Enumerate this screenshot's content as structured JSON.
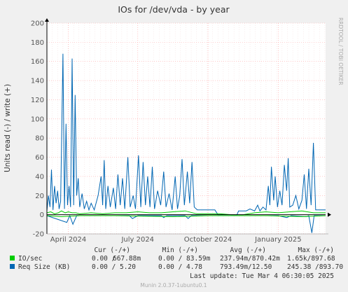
{
  "chart_data": {
    "type": "line",
    "title": "IOs for /dev/vda - by year",
    "ylabel": "Units read (-) / write (+)",
    "side_label": "RRDTOOL / TOBI OETIKER",
    "ylim": [
      -20,
      200
    ],
    "yticks": [
      -20,
      0,
      20,
      40,
      60,
      80,
      100,
      120,
      140,
      160,
      180,
      200
    ],
    "xticks": [
      "April 2024",
      "July 2024",
      "October 2024",
      "January 2025"
    ],
    "x_range": [
      "2024-03-04",
      "2025-03-04"
    ],
    "x_tick_dates": [
      "2024-04-01",
      "2024-07-01",
      "2024-10-01",
      "2025-01-01"
    ],
    "colors": {
      "io": "#00cc00",
      "req": "#0066b3",
      "grid": "#ffaaaa",
      "zero": "#000000"
    },
    "series": [
      {
        "name": "IO/sec",
        "color": "#00cc00",
        "write": [
          [
            "2024-03-04",
            2
          ],
          [
            "2024-03-09",
            3
          ],
          [
            "2024-03-14",
            1
          ],
          [
            "2024-03-19",
            2
          ],
          [
            "2024-03-23",
            4
          ],
          [
            "2024-03-28",
            2
          ],
          [
            "2024-04-01",
            3
          ],
          [
            "2024-04-06",
            2
          ],
          [
            "2024-04-11",
            2
          ],
          [
            "2024-04-16",
            1
          ],
          [
            "2024-05-01",
            2
          ],
          [
            "2024-05-16",
            1
          ],
          [
            "2024-06-01",
            2
          ],
          [
            "2024-06-16",
            2
          ],
          [
            "2024-07-01",
            3
          ],
          [
            "2024-07-16",
            2
          ],
          [
            "2024-08-01",
            2
          ],
          [
            "2024-08-16",
            3
          ],
          [
            "2024-09-01",
            4
          ],
          [
            "2024-09-16",
            1
          ],
          [
            "2024-10-01",
            1
          ],
          [
            "2024-10-16",
            1
          ],
          [
            "2024-11-01",
            0
          ],
          [
            "2024-11-16",
            0
          ],
          [
            "2024-12-01",
            2
          ],
          [
            "2024-12-16",
            3
          ],
          [
            "2025-01-01",
            2
          ],
          [
            "2025-01-16",
            3
          ],
          [
            "2025-02-01",
            4
          ],
          [
            "2025-02-16",
            2
          ],
          [
            "2025-03-04",
            2
          ]
        ],
        "read": [
          [
            "2024-03-04",
            -1
          ],
          [
            "2024-03-23",
            -2
          ],
          [
            "2024-04-16",
            -1
          ],
          [
            "2024-06-01",
            -1
          ],
          [
            "2024-08-16",
            -2
          ],
          [
            "2024-10-01",
            -1
          ],
          [
            "2024-12-16",
            -1
          ],
          [
            "2025-02-01",
            -2
          ],
          [
            "2025-03-04",
            -1
          ]
        ]
      },
      {
        "name": "Req Size (KB)",
        "color": "#0066b3",
        "write": [
          [
            "2024-03-04",
            4
          ],
          [
            "2024-03-06",
            20
          ],
          [
            "2024-03-08",
            8
          ],
          [
            "2024-03-10",
            47
          ],
          [
            "2024-03-12",
            5
          ],
          [
            "2024-03-14",
            30
          ],
          [
            "2024-03-16",
            12
          ],
          [
            "2024-03-18",
            25
          ],
          [
            "2024-03-20",
            6
          ],
          [
            "2024-03-22",
            14
          ],
          [
            "2024-03-25",
            168
          ],
          [
            "2024-03-27",
            6
          ],
          [
            "2024-03-29",
            95
          ],
          [
            "2024-03-31",
            10
          ],
          [
            "2024-04-02",
            30
          ],
          [
            "2024-04-04",
            8
          ],
          [
            "2024-04-06",
            163
          ],
          [
            "2024-04-08",
            10
          ],
          [
            "2024-04-10",
            125
          ],
          [
            "2024-04-12",
            20
          ],
          [
            "2024-04-14",
            38
          ],
          [
            "2024-04-16",
            8
          ],
          [
            "2024-04-19",
            22
          ],
          [
            "2024-04-22",
            6
          ],
          [
            "2024-04-25",
            14
          ],
          [
            "2024-04-28",
            5
          ],
          [
            "2024-05-01",
            12
          ],
          [
            "2024-05-05",
            5
          ],
          [
            "2024-05-10",
            20
          ],
          [
            "2024-05-14",
            40
          ],
          [
            "2024-05-16",
            10
          ],
          [
            "2024-05-18",
            57
          ],
          [
            "2024-05-20",
            6
          ],
          [
            "2024-05-23",
            30
          ],
          [
            "2024-05-26",
            8
          ],
          [
            "2024-05-30",
            28
          ],
          [
            "2024-06-02",
            6
          ],
          [
            "2024-06-05",
            42
          ],
          [
            "2024-06-08",
            10
          ],
          [
            "2024-06-11",
            38
          ],
          [
            "2024-06-14",
            6
          ],
          [
            "2024-06-18",
            60
          ],
          [
            "2024-06-21",
            8
          ],
          [
            "2024-06-25",
            20
          ],
          [
            "2024-06-28",
            6
          ],
          [
            "2024-07-02",
            62
          ],
          [
            "2024-07-05",
            8
          ],
          [
            "2024-07-08",
            55
          ],
          [
            "2024-07-11",
            10
          ],
          [
            "2024-07-14",
            40
          ],
          [
            "2024-07-17",
            8
          ],
          [
            "2024-07-20",
            50
          ],
          [
            "2024-07-23",
            6
          ],
          [
            "2024-07-27",
            25
          ],
          [
            "2024-07-31",
            10
          ],
          [
            "2024-08-04",
            45
          ],
          [
            "2024-08-07",
            8
          ],
          [
            "2024-08-11",
            22
          ],
          [
            "2024-08-15",
            5
          ],
          [
            "2024-08-19",
            40
          ],
          [
            "2024-08-22",
            6
          ],
          [
            "2024-08-25",
            20
          ],
          [
            "2024-08-28",
            58
          ],
          [
            "2024-08-31",
            10
          ],
          [
            "2024-09-04",
            45
          ],
          [
            "2024-09-07",
            12
          ],
          [
            "2024-09-10",
            55
          ],
          [
            "2024-09-13",
            8
          ],
          [
            "2024-09-17",
            5
          ],
          [
            "2024-09-22",
            5
          ],
          [
            "2024-10-01",
            5
          ],
          [
            "2024-10-10",
            5
          ],
          [
            "2024-10-14",
            0
          ],
          [
            "2024-11-08",
            0
          ],
          [
            "2024-11-10",
            4
          ],
          [
            "2024-11-20",
            4
          ],
          [
            "2024-11-25",
            6
          ],
          [
            "2024-12-01",
            4
          ],
          [
            "2024-12-05",
            10
          ],
          [
            "2024-12-08",
            4
          ],
          [
            "2024-12-12",
            8
          ],
          [
            "2024-12-16",
            5
          ],
          [
            "2024-12-19",
            30
          ],
          [
            "2024-12-21",
            10
          ],
          [
            "2024-12-23",
            50
          ],
          [
            "2024-12-26",
            15
          ],
          [
            "2024-12-28",
            40
          ],
          [
            "2024-12-31",
            8
          ],
          [
            "2025-01-03",
            25
          ],
          [
            "2025-01-06",
            10
          ],
          [
            "2025-01-09",
            52
          ],
          [
            "2025-01-12",
            25
          ],
          [
            "2025-01-14",
            59
          ],
          [
            "2025-01-16",
            8
          ],
          [
            "2025-01-20",
            10
          ],
          [
            "2025-01-24",
            20
          ],
          [
            "2025-01-28",
            6
          ],
          [
            "2025-02-01",
            15
          ],
          [
            "2025-02-04",
            42
          ],
          [
            "2025-02-07",
            6
          ],
          [
            "2025-02-10",
            48
          ],
          [
            "2025-02-13",
            10
          ],
          [
            "2025-02-16",
            75
          ],
          [
            "2025-02-19",
            5
          ],
          [
            "2025-03-04",
            5
          ]
        ],
        "read": [
          [
            "2024-03-04",
            -1
          ],
          [
            "2024-03-30",
            -8
          ],
          [
            "2024-04-03",
            -1
          ],
          [
            "2024-04-07",
            -10
          ],
          [
            "2024-04-12",
            -1
          ],
          [
            "2024-06-20",
            -1
          ],
          [
            "2024-06-24",
            -4
          ],
          [
            "2024-07-01",
            -1
          ],
          [
            "2024-08-01",
            -1
          ],
          [
            "2024-08-04",
            -3
          ],
          [
            "2024-08-08",
            -1
          ],
          [
            "2024-09-01",
            -1
          ],
          [
            "2024-09-05",
            -4
          ],
          [
            "2024-09-09",
            -1
          ],
          [
            "2024-12-01",
            -1
          ],
          [
            "2025-01-01",
            -1
          ],
          [
            "2025-01-12",
            -3
          ],
          [
            "2025-01-18",
            -1
          ],
          [
            "2025-02-07",
            -2
          ],
          [
            "2025-02-10",
            -1
          ],
          [
            "2025-02-14",
            -19
          ],
          [
            "2025-02-17",
            -1
          ],
          [
            "2025-03-04",
            -1
          ]
        ]
      }
    ]
  },
  "legend": {
    "headers": [
      "Cur (-/+)",
      "Min (-/+)",
      "Avg (-/+)",
      "Max (-/+)"
    ],
    "rows": [
      {
        "label": "IO/sec",
        "color": "#00cc00",
        "cur": "0.00 /",
        "cur2": "667.88m",
        "min": "0.00 / 83.59m",
        "avg": "237.94m/870.42m",
        "max": "1.65k/897.68"
      },
      {
        "label": "Req Size (KB)",
        "color": "#0066b3",
        "cur": "0.00 / 5.20",
        "cur2": "",
        "min": "0.00 / 4.78",
        "avg": "793.49m/12.50",
        "max": "245.38 /893.70"
      }
    ]
  },
  "last_update": "Last update: Tue Mar  4 06:30:05 2025",
  "footer": "Munin 2.0.37-1ubuntu0.1"
}
